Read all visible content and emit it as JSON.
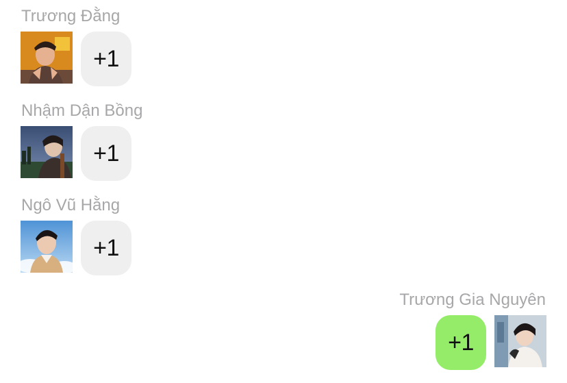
{
  "messages": [
    {
      "sender": "Trương Đằng",
      "text": "+1",
      "side": "left",
      "bubble_color": "#efefef"
    },
    {
      "sender": "Nhậm Dận Bồng",
      "text": "+1",
      "side": "left",
      "bubble_color": "#efefef"
    },
    {
      "sender": "Ngô Vũ Hằng",
      "text": "+1",
      "side": "left",
      "bubble_color": "#efefef"
    },
    {
      "sender": "Trương Gia Nguyên",
      "text": "+1",
      "side": "right",
      "bubble_color": "#95ec69"
    }
  ],
  "colors": {
    "sender_name": "#a7a7a9",
    "incoming_bubble": "#efefef",
    "outgoing_bubble": "#95ec69",
    "text": "#111111"
  }
}
